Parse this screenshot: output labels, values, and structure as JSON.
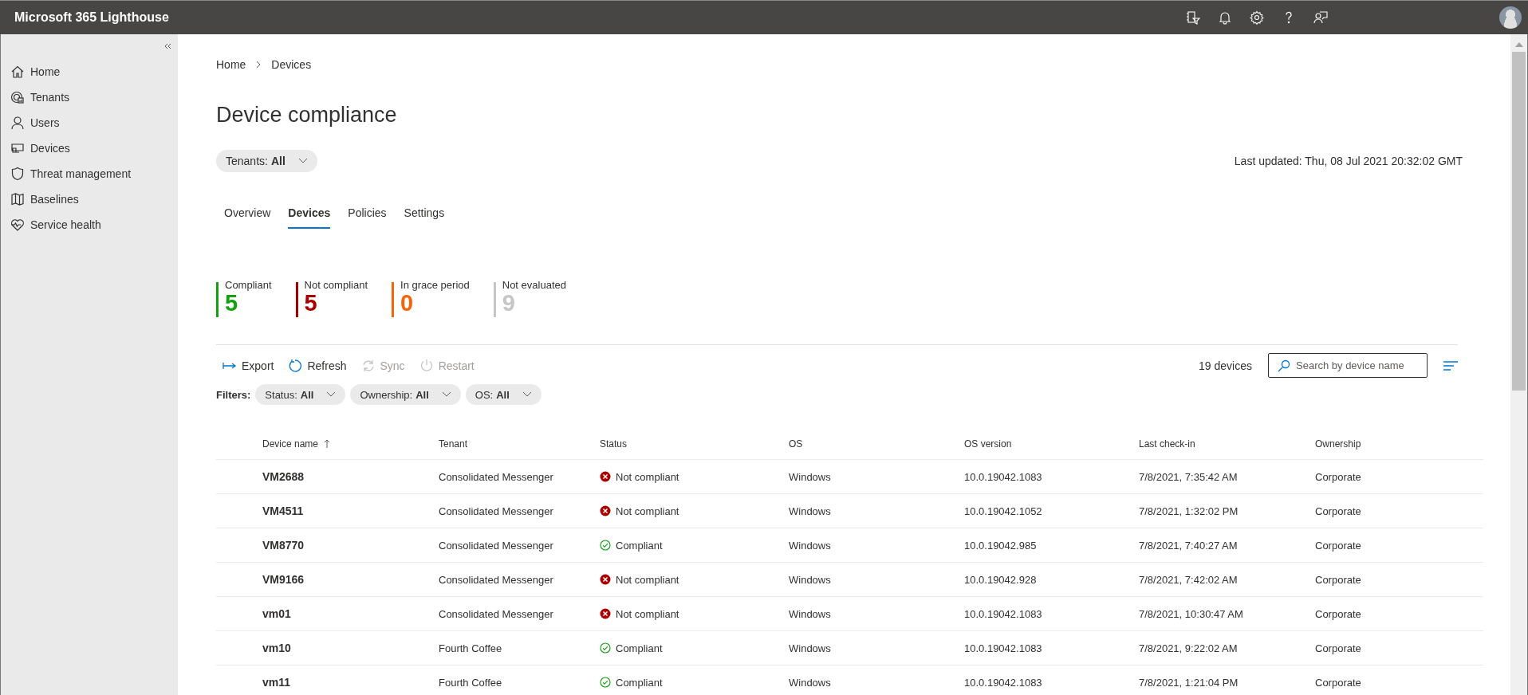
{
  "app_bar": {
    "title": "Microsoft 365 Lighthouse"
  },
  "sidebar": {
    "items": [
      {
        "label": "Home"
      },
      {
        "label": "Tenants"
      },
      {
        "label": "Users"
      },
      {
        "label": "Devices"
      },
      {
        "label": "Threat management"
      },
      {
        "label": "Baselines"
      },
      {
        "label": "Service health"
      }
    ]
  },
  "breadcrumb": [
    "Home",
    "Devices"
  ],
  "page_title": "Device compliance",
  "tenant_filter": {
    "label": "Tenants:",
    "value": "All"
  },
  "last_updated": "Last updated: Thu, 08 Jul 2021 20:32:02 GMT",
  "tabs": [
    {
      "label": "Overview",
      "selected": false
    },
    {
      "label": "Devices",
      "selected": true
    },
    {
      "label": "Policies",
      "selected": false
    },
    {
      "label": "Settings",
      "selected": false
    }
  ],
  "stats": [
    {
      "label": "Compliant",
      "value": "5",
      "color": "#13a10e"
    },
    {
      "label": "Not compliant",
      "value": "5",
      "color": "#a80000"
    },
    {
      "label": "In grace period",
      "value": "0",
      "color": "#f7630c"
    },
    {
      "label": "Not evaluated",
      "value": "9",
      "color": "#c8c6c4"
    }
  ],
  "toolbar": [
    {
      "label": "Export",
      "disabled": false
    },
    {
      "label": "Refresh",
      "disabled": false
    },
    {
      "label": "Sync",
      "disabled": true
    },
    {
      "label": "Restart",
      "disabled": true
    }
  ],
  "device_count": "19 devices",
  "search": {
    "placeholder": "Search by device name"
  },
  "filters": {
    "label": "Filters:",
    "items": [
      {
        "label": "Status:",
        "value": "All"
      },
      {
        "label": "Ownership:",
        "value": "All"
      },
      {
        "label": "OS:",
        "value": "All"
      }
    ]
  },
  "table": {
    "columns": [
      "Device name",
      "Tenant",
      "Status",
      "OS",
      "OS version",
      "Last check-in",
      "Ownership"
    ],
    "rows": [
      {
        "device": "VM2688",
        "tenant": "Consolidated Messenger",
        "status": "Not compliant",
        "compliant": false,
        "os": "Windows",
        "os_version": "10.0.19042.1083",
        "last_check_in": "7/8/2021, 7:35:42 AM",
        "ownership": "Corporate"
      },
      {
        "device": "VM4511",
        "tenant": "Consolidated Messenger",
        "status": "Not compliant",
        "compliant": false,
        "os": "Windows",
        "os_version": "10.0.19042.1052",
        "last_check_in": "7/8/2021, 1:32:02 PM",
        "ownership": "Corporate"
      },
      {
        "device": "VM8770",
        "tenant": "Consolidated Messenger",
        "status": "Compliant",
        "compliant": true,
        "os": "Windows",
        "os_version": "10.0.19042.985",
        "last_check_in": "7/8/2021, 7:40:27 AM",
        "ownership": "Corporate"
      },
      {
        "device": "VM9166",
        "tenant": "Consolidated Messenger",
        "status": "Not compliant",
        "compliant": false,
        "os": "Windows",
        "os_version": "10.0.19042.928",
        "last_check_in": "7/8/2021, 7:42:02 AM",
        "ownership": "Corporate"
      },
      {
        "device": "vm01",
        "tenant": "Consolidated Messenger",
        "status": "Not compliant",
        "compliant": false,
        "os": "Windows",
        "os_version": "10.0.19042.1083",
        "last_check_in": "7/8/2021, 10:30:47 AM",
        "ownership": "Corporate"
      },
      {
        "device": "vm10",
        "tenant": "Fourth Coffee",
        "status": "Compliant",
        "compliant": true,
        "os": "Windows",
        "os_version": "10.0.19042.1083",
        "last_check_in": "7/8/2021, 9:22:02 AM",
        "ownership": "Corporate"
      },
      {
        "device": "vm11",
        "tenant": "Fourth Coffee",
        "status": "Compliant",
        "compliant": true,
        "os": "Windows",
        "os_version": "10.0.19042.1083",
        "last_check_in": "7/8/2021, 1:21:04 PM",
        "ownership": "Corporate"
      }
    ]
  }
}
